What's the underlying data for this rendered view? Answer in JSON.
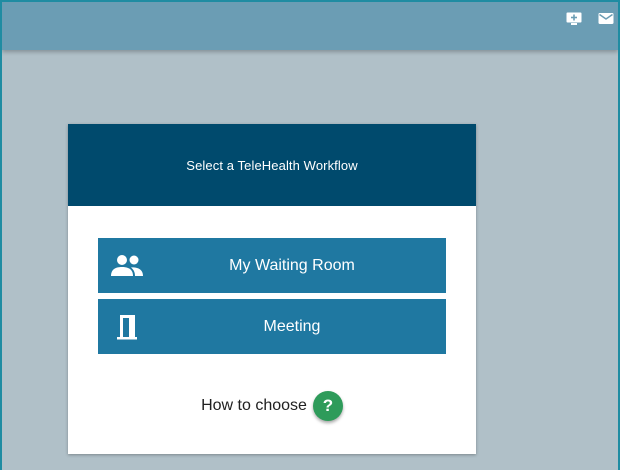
{
  "topbar": {
    "icons": [
      "add-to-screen-icon",
      "mail-icon"
    ]
  },
  "card": {
    "header_title": "Select a TeleHealth Workflow",
    "buttons": [
      {
        "label": "My Waiting Room",
        "icon": "people-icon"
      },
      {
        "label": "Meeting",
        "icon": "door-icon"
      }
    ],
    "how_to_label": "How to choose",
    "help_glyph": "?"
  },
  "colors": {
    "topbar": "#6b9db4",
    "background": "#b0c0c8",
    "header": "#004a6d",
    "button": "#1f78a1",
    "help": "#2e9b5a",
    "frame_border": "#1f8ca2"
  }
}
